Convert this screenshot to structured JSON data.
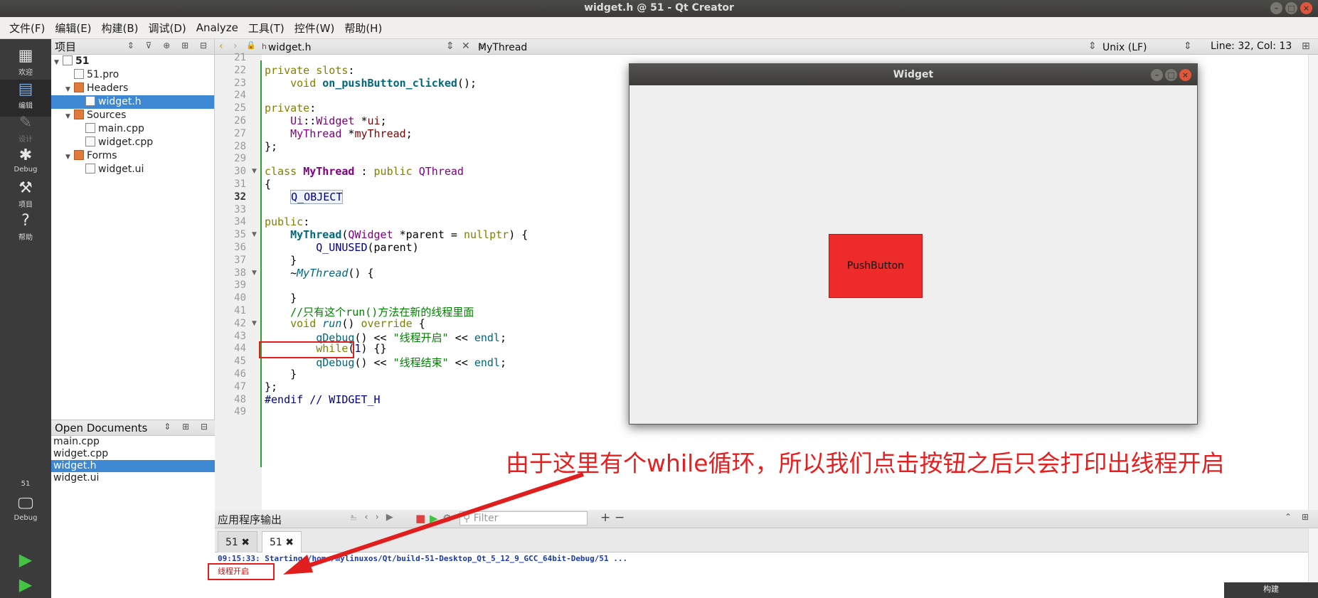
{
  "window": {
    "title": "widget.h @ 51 - Qt Creator"
  },
  "menu": [
    "文件(F)",
    "编辑(E)",
    "构建(B)",
    "调试(D)",
    "Analyze",
    "工具(T)",
    "控件(W)",
    "帮助(H)"
  ],
  "modes": [
    {
      "label": "欢迎",
      "icon": "grid-icon",
      "glyph": "▦"
    },
    {
      "label": "编辑",
      "icon": "edit-icon",
      "glyph": "▤"
    },
    {
      "label": "设计",
      "icon": "pencil-icon",
      "glyph": "✎"
    },
    {
      "label": "Debug",
      "icon": "bug-icon",
      "glyph": "✱"
    },
    {
      "label": "项目",
      "icon": "wrench-icon",
      "glyph": "⚒"
    },
    {
      "label": "帮助",
      "icon": "help-icon",
      "glyph": "?"
    }
  ],
  "kit": {
    "name": "51",
    "mode": "Debug"
  },
  "project_pane": {
    "title": "项目",
    "tree": [
      {
        "label": "51",
        "depth": 0,
        "arrow": "▼",
        "icon": "project-icon"
      },
      {
        "label": "51.pro",
        "depth": 1,
        "arrow": "",
        "icon": "pro-file-icon"
      },
      {
        "label": "Headers",
        "depth": 1,
        "arrow": "▼",
        "icon": "folder-icon"
      },
      {
        "label": "widget.h",
        "depth": 2,
        "arrow": "",
        "icon": "header-file-icon",
        "selected": true
      },
      {
        "label": "Sources",
        "depth": 1,
        "arrow": "▼",
        "icon": "folder-icon"
      },
      {
        "label": "main.cpp",
        "depth": 2,
        "arrow": "",
        "icon": "cpp-file-icon"
      },
      {
        "label": "widget.cpp",
        "depth": 2,
        "arrow": "",
        "icon": "cpp-file-icon"
      },
      {
        "label": "Forms",
        "depth": 1,
        "arrow": "▼",
        "icon": "folder-icon"
      },
      {
        "label": "widget.ui",
        "depth": 2,
        "arrow": "",
        "icon": "ui-file-icon"
      }
    ]
  },
  "open_documents": {
    "title": "Open Documents",
    "items": [
      {
        "label": "main.cpp"
      },
      {
        "label": "widget.cpp"
      },
      {
        "label": "widget.h",
        "selected": true
      },
      {
        "label": "widget.ui"
      }
    ]
  },
  "editor_toolbar": {
    "file": "widget.h",
    "symbol": "MyThread",
    "line_ending": "Unix (LF)",
    "position": "Line: 32, Col: 13"
  },
  "editor": {
    "current_line": 32,
    "fold_lines": [
      30,
      35,
      38,
      42
    ],
    "lines": [
      {
        "n": 21,
        "html": ""
      },
      {
        "n": 22,
        "html": "<span class='kw'>private</span> <span class='kw'>slots</span>:"
      },
      {
        "n": 23,
        "html": "    <span class='kw'>void</span> <span class='fn'>on_pushButton_clicked</span>();"
      },
      {
        "n": 24,
        "html": ""
      },
      {
        "n": 25,
        "html": "<span class='kw'>private</span>:"
      },
      {
        "n": 26,
        "html": "    <span class='ns'>Ui</span>::<span class='ty'>Widget</span> *<span class='mem'>ui</span>;"
      },
      {
        "n": 27,
        "html": "    <span class='ty'>MyThread</span> *<span class='mem'>myThread</span>;"
      },
      {
        "n": 28,
        "html": "};"
      },
      {
        "n": 29,
        "html": ""
      },
      {
        "n": 30,
        "html": "<span class='kw'>class</span> <span class='ty' style='font-weight:bold'>MyThread</span> : <span class='kw'>public</span> <span class='ty'>QThread</span>"
      },
      {
        "n": 31,
        "html": "{"
      },
      {
        "n": 32,
        "html": "    <span class='mac' style='border:1px solid #9ab;background:#eef3f8'>Q_OBJECT</span>"
      },
      {
        "n": 33,
        "html": ""
      },
      {
        "n": 34,
        "html": "<span class='kw'>public</span>:"
      },
      {
        "n": 35,
        "html": "    <span class='fn'>MyThread</span>(<span class='ty'>QWidget</span> *parent = <span class='kw'>nullptr</span>) {"
      },
      {
        "n": 36,
        "html": "        <span class='mac'>Q_UNUSED</span>(parent)"
      },
      {
        "n": 37,
        "html": "    }"
      },
      {
        "n": 38,
        "html": "    ~<span class='fni'>MyThread</span>() {"
      },
      {
        "n": 39,
        "html": ""
      },
      {
        "n": 40,
        "html": "    }"
      },
      {
        "n": 41,
        "html": "    <span class='cm'>//只有这个run()方法在新的线程里面</span>"
      },
      {
        "n": 42,
        "html": "    <span class='kw'>void</span> <span class='fni'>run</span>() <span class='kw'>override</span> {"
      },
      {
        "n": 43,
        "html": "        <span class='fn' style='font-weight:normal'>qDebug</span>() << <span class='st'>\"线程开启\"</span> << <span class='fn' style='font-weight:normal'>endl</span>;"
      },
      {
        "n": 44,
        "html": "        <span class='kw'>while</span>(<span class='num'>1</span>) {}"
      },
      {
        "n": 45,
        "html": "        <span class='fn' style='font-weight:normal'>qDebug</span>() << <span class='st'>\"线程结束\"</span> << <span class='fn' style='font-weight:normal'>endl</span>;"
      },
      {
        "n": 46,
        "html": "    }"
      },
      {
        "n": 47,
        "html": "};"
      },
      {
        "n": 48,
        "html": "<span class='mac'>#endif</span> <span class='cm' style='color:#000080'>// WIDGET_H</span>"
      },
      {
        "n": 49,
        "html": ""
      }
    ]
  },
  "output_pane": {
    "title": "应用程序输出",
    "filter_placeholder": "Filter",
    "tabs": [
      "51 ✖",
      "51 ✖"
    ],
    "log": [
      "09:15:33: Starting /home/mylinuxos/Qt/build-51-Desktop_Qt_5_12_9_GCC_64bit-Debug/51 ...",
      "线程开启"
    ]
  },
  "widget_window": {
    "title": "Widget",
    "button_label": "PushButton",
    "button_color": "#ee2b2b"
  },
  "annotation": {
    "text": "由于这里有个while循环，所以我们点击按钮之后只会打印出线程开启",
    "color": "#e81f1f"
  },
  "build_tag": "构建"
}
